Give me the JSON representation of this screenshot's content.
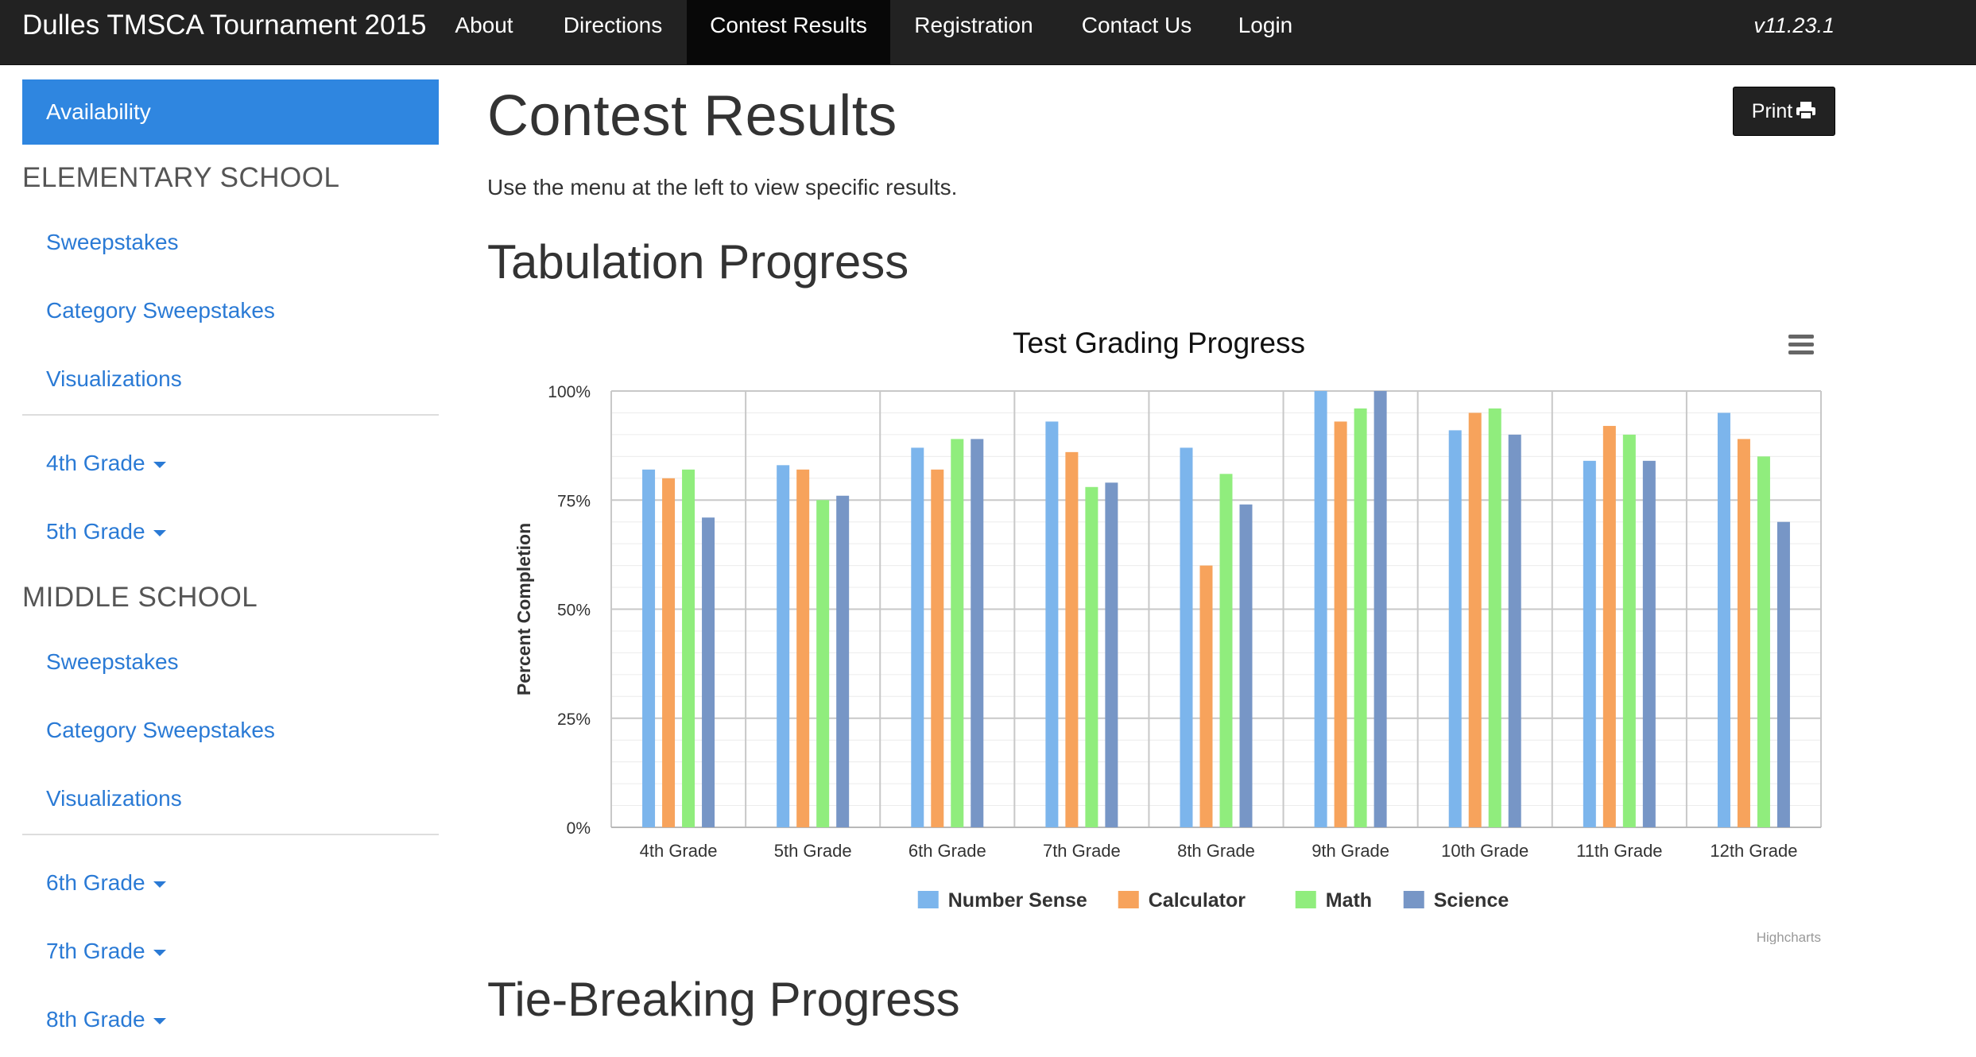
{
  "navbar": {
    "brand": "Dulles TMSCA Tournament 2015",
    "items": [
      "About",
      "Directions",
      "Contest Results",
      "Registration",
      "Contact Us",
      "Login"
    ],
    "active": "Contest Results",
    "version": "v11.23.1"
  },
  "sidebar": {
    "availability": "Availability",
    "elementary": {
      "heading": "ELEMENTARY SCHOOL",
      "links": [
        "Sweepstakes",
        "Category Sweepstakes",
        "Visualizations"
      ],
      "grades": [
        "4th Grade",
        "5th Grade"
      ]
    },
    "middle": {
      "heading": "MIDDLE SCHOOL",
      "links": [
        "Sweepstakes",
        "Category Sweepstakes",
        "Visualizations"
      ],
      "grades": [
        "6th Grade",
        "7th Grade",
        "8th Grade"
      ]
    }
  },
  "main": {
    "title": "Contest Results",
    "intro": "Use the menu at the left to view specific results.",
    "print_label": "Print",
    "section1": "Tabulation Progress",
    "section2": "Tie-Breaking Progress"
  },
  "chart_data": {
    "type": "bar",
    "title": "Test Grading Progress",
    "xlabel": "",
    "ylabel": "Percent Completion",
    "ylim": [
      0,
      100
    ],
    "yticks": [
      "0%",
      "25%",
      "50%",
      "75%",
      "100%"
    ],
    "grid": true,
    "legend": "bottom-center",
    "credits": "Highcharts",
    "categories": [
      "4th Grade",
      "5th Grade",
      "6th Grade",
      "7th Grade",
      "8th Grade",
      "9th Grade",
      "10th Grade",
      "11th Grade",
      "12th Grade"
    ],
    "series": [
      {
        "name": "Number Sense",
        "color": "#7cb5ec",
        "values": [
          82,
          83,
          87,
          93,
          87,
          100,
          91,
          84,
          95
        ]
      },
      {
        "name": "Calculator",
        "color": "#f7a35c",
        "values": [
          80,
          82,
          82,
          86,
          60,
          93,
          95,
          92,
          89
        ]
      },
      {
        "name": "Math",
        "color": "#90ed7d",
        "values": [
          82,
          75,
          89,
          78,
          81,
          96,
          96,
          90,
          85
        ]
      },
      {
        "name": "Science",
        "color": "#7796c6",
        "values": [
          71,
          76,
          89,
          79,
          74,
          100,
          90,
          84,
          70
        ]
      }
    ]
  }
}
